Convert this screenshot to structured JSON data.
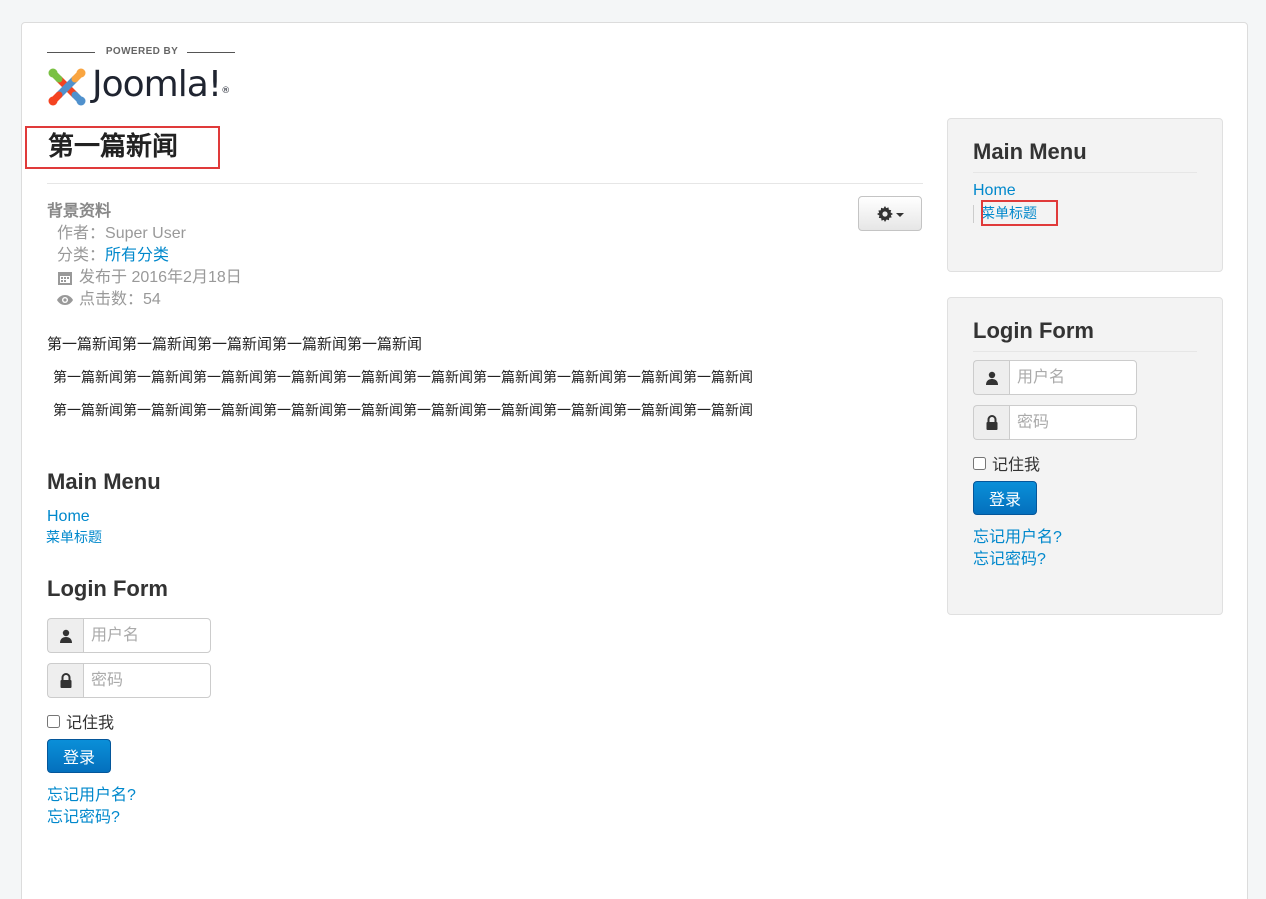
{
  "logo": {
    "powered_by": "POWERED BY",
    "brand": "Joomla!",
    "reg": "®"
  },
  "article": {
    "title": "第一篇新闻",
    "info_heading": "背景资料",
    "author_label": "作者：",
    "author": "Super User",
    "category_label": "分类：",
    "category": "所有分类",
    "published": "发布于 2016年2月18日",
    "hits": "点击数：54",
    "p1": "第一篇新闻第一篇新闻第一篇新闻第一篇新闻第一篇新闻",
    "p2": "第一篇新闻第一篇新闻第一篇新闻第一篇新闻第一篇新闻第一篇新闻第一篇新闻第一篇新闻第一篇新闻第一篇新闻",
    "p3": "第一篇新闻第一篇新闻第一篇新闻第一篇新闻第一篇新闻第一篇新闻第一篇新闻第一篇新闻第一篇新闻第一篇新闻",
    "tools_icon": "gear-icon"
  },
  "main_menu": {
    "title": "Main Menu",
    "home": "Home",
    "item": "菜单标题"
  },
  "login_form": {
    "title": "Login Form",
    "username_placeholder": "用户名",
    "password_placeholder": "密码",
    "remember": "记住我",
    "submit": "登录",
    "forgot_username": "忘记用户名?",
    "forgot_password": "忘记密码?"
  },
  "sidebar_menu": {
    "title": "Main Menu",
    "home": "Home",
    "item": "菜单标题"
  },
  "sidebar_login": {
    "title": "Login Form",
    "username_placeholder": "用户名",
    "password_placeholder": "密码",
    "remember": "记住我",
    "submit": "登录",
    "forgot_username": "忘记用户名?",
    "forgot_password": "忘记密码?"
  },
  "colors": {
    "link": "#0088cc",
    "button": "#0470bd",
    "highlight_box": "#e03a3a"
  }
}
